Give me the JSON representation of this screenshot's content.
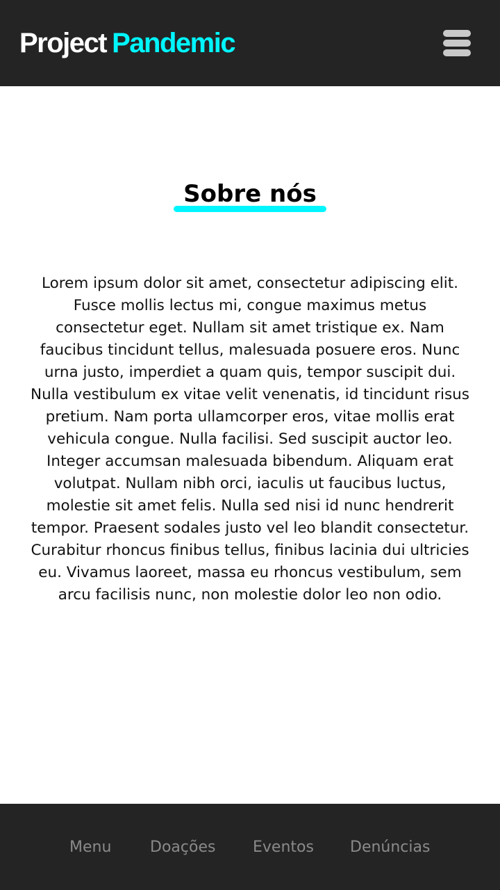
{
  "header": {
    "brand_first": "Project",
    "brand_second": "Pandemic",
    "menu_icon": "hamburger-menu-icon"
  },
  "main": {
    "title": "Sobre nós",
    "body": "Lorem ipsum dolor sit amet, consectetur adipiscing elit. Fusce mollis lectus mi, congue maximus metus consectetur eget. Nullam sit amet tristique ex. Nam faucibus tincidunt tellus, malesuada posuere eros. Nunc urna justo, imperdiet a quam quis, tempor suscipit dui. Nulla vestibulum ex vitae velit venenatis, id tincidunt risus pretium. Nam porta ullamcorper eros, vitae mollis erat vehicula congue. Nulla facilisi. Sed suscipit auctor leo. Integer accumsan malesuada bibendum. Aliquam erat volutpat. Nullam nibh orci, iaculis ut faucibus luctus, molestie sit amet felis. Nulla sed nisi id nunc hendrerit tempor. Praesent sodales justo vel leo blandit consectetur. Curabitur rhoncus finibus tellus, finibus lacinia dui ultricies eu. Vivamus laoreet, massa eu rhoncus vestibulum, sem arcu facilisis nunc, non molestie dolor leo non odio."
  },
  "footer_nav": {
    "items": [
      {
        "label": "Menu"
      },
      {
        "label": "Doações"
      },
      {
        "label": "Eventos"
      },
      {
        "label": "Denúncias"
      }
    ]
  },
  "colors": {
    "bar_background": "#242424",
    "accent": "#00f6ff",
    "nav_text": "#8a8a8a"
  }
}
